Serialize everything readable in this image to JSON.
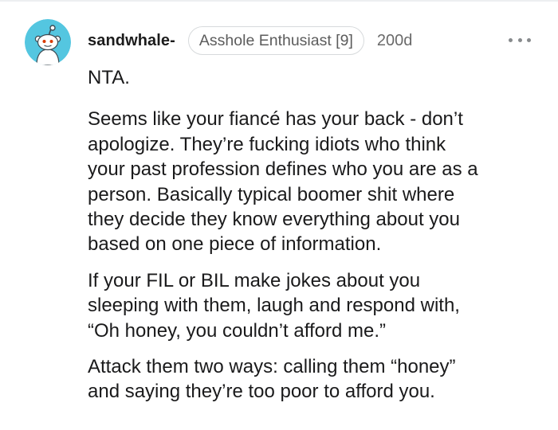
{
  "comment": {
    "username": "sandwhale-",
    "flair": "Asshole Enthusiast [9]",
    "age": "200d",
    "more_icon": "ellipsis-icon",
    "avatar_icon": "snoo-avatar",
    "accent_color": "#54c6e0",
    "paragraphs": [
      [
        "NTA."
      ],
      [
        "Seems like your fiancé has your back - don’t",
        "apologize. They’re fucking idiots who think",
        "your past profession defines who you are as a",
        "person. Basically typical boomer shit where",
        "they decide they know everything about you",
        "based on one piece of information."
      ],
      [
        "If your FIL or BIL make jokes about you",
        "sleeping with them, laugh and respond with,",
        "“Oh honey, you couldn’t afford me.”"
      ],
      [
        "Attack them two ways: calling them “honey”",
        "and saying they’re too poor to afford you."
      ]
    ]
  }
}
